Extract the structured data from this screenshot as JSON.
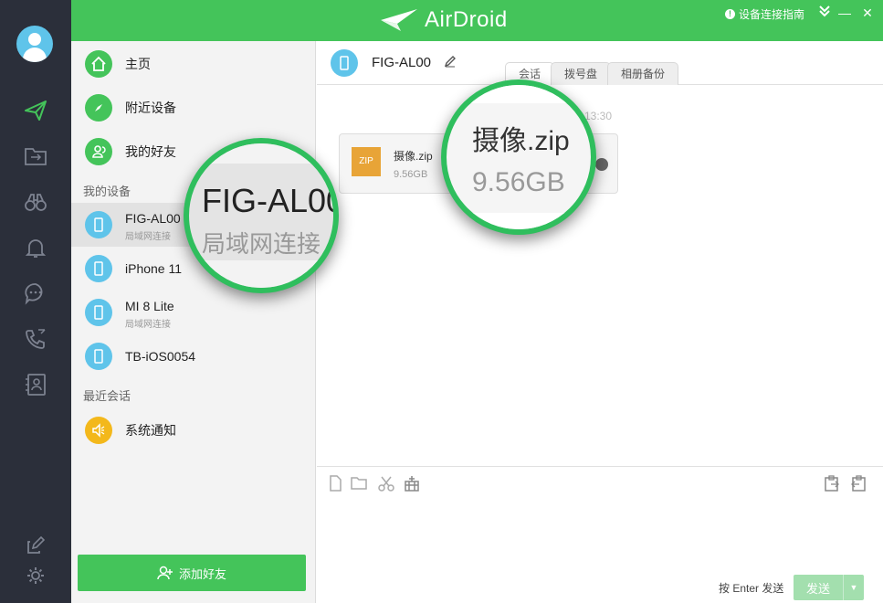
{
  "app": {
    "name": "AirDroid",
    "accent": "#44c45a"
  },
  "topbar": {
    "guide_label": "设备连接指南",
    "download_icon": "download-icon",
    "minimize": "—",
    "close": "✕"
  },
  "nav": {
    "items": [
      {
        "label": "主页",
        "icon": "home-icon"
      },
      {
        "label": "附近设备",
        "icon": "compass-icon"
      },
      {
        "label": "我的好友",
        "icon": "friends-icon"
      }
    ],
    "my_devices_label": "我的设备",
    "recent_label": "最近会话"
  },
  "devices": [
    {
      "name": "FIG-AL00",
      "sub": "局域网连接",
      "selected": true
    },
    {
      "name": "iPhone 11",
      "sub": ""
    },
    {
      "name": "MI 8 Lite",
      "sub": "局域网连接"
    },
    {
      "name": "TB-iOS0054",
      "sub": ""
    }
  ],
  "recent": [
    {
      "name": "系统通知",
      "icon": "speaker-icon"
    }
  ],
  "add_friend_label": "添加好友",
  "chat": {
    "device_name": "FIG-AL00",
    "tabs": [
      "会话",
      "拨号盘",
      "相册备份"
    ],
    "timestamp": "13:30",
    "file": {
      "type_label": "ZIP",
      "name": "摄像.zip",
      "size": "9.56GB"
    },
    "enter_hint": "按 Enter 发送",
    "send_label": "发送"
  },
  "magnifier1": {
    "name": "FIG-AL00",
    "sub": "局域网连接"
  },
  "magnifier2": {
    "name": "摄像.zip",
    "size": "9.56GB"
  }
}
